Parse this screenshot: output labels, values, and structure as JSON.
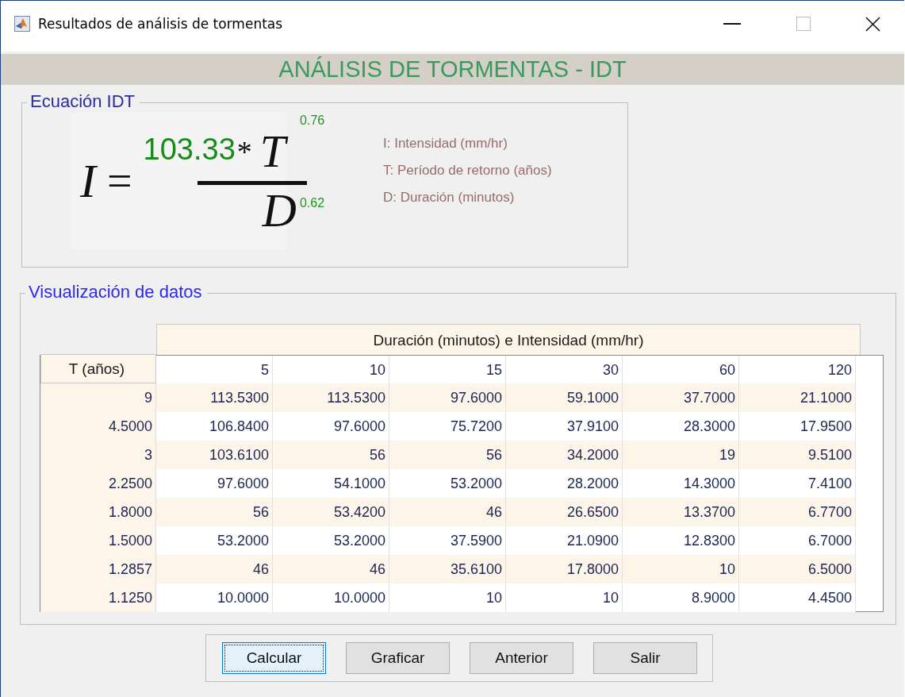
{
  "window": {
    "title": "Resultados de análisis de tormentas"
  },
  "banner": "ANÁLISIS DE TORMENTAS - IDT",
  "equation_panel": {
    "title": "Ecuación IDT",
    "formula": {
      "lhs": "I",
      "equals": "=",
      "coefficient": "103.33",
      "times": "*",
      "numerator_var": "T",
      "numerator_exponent": "0.76",
      "denominator_var": "D",
      "denominator_exponent": "0.62"
    },
    "legend": [
      "I: Intensidad (mm/hr)",
      "T: Período de retorno (años)",
      "D: Duración (minutos)"
    ]
  },
  "data_panel": {
    "title": "Visualización de datos",
    "table": {
      "group_header": "Duración (minutos) e Intensidad (mm/hr)",
      "row_header_title": "T (años)",
      "columns": [
        "5",
        "10",
        "15",
        "30",
        "60",
        "120"
      ],
      "rows": [
        {
          "t": "9",
          "values": [
            "113.5300",
            "113.5300",
            "97.6000",
            "59.1000",
            "37.7000",
            "21.1000"
          ]
        },
        {
          "t": "4.5000",
          "values": [
            "106.8400",
            "97.6000",
            "75.7200",
            "37.9100",
            "28.3000",
            "17.9500"
          ]
        },
        {
          "t": "3",
          "values": [
            "103.6100",
            "56",
            "56",
            "34.2000",
            "19",
            "9.5100"
          ]
        },
        {
          "t": "2.2500",
          "values": [
            "97.6000",
            "54.1000",
            "53.2000",
            "28.2000",
            "14.3000",
            "7.4100"
          ]
        },
        {
          "t": "1.8000",
          "values": [
            "56",
            "53.4200",
            "46",
            "26.6500",
            "13.3700",
            "6.7700"
          ]
        },
        {
          "t": "1.5000",
          "values": [
            "53.2000",
            "53.2000",
            "37.5900",
            "21.0900",
            "12.8300",
            "6.7000"
          ]
        },
        {
          "t": "1.2857",
          "values": [
            "46",
            "46",
            "35.6100",
            "17.8000",
            "10",
            "6.5000"
          ]
        },
        {
          "t": "1.1250",
          "values": [
            "10.0000",
            "10.0000",
            "10",
            "10",
            "8.9000",
            "4.4500"
          ]
        }
      ]
    }
  },
  "buttons": [
    {
      "label": "Calcular",
      "focused": true
    },
    {
      "label": "Graficar",
      "focused": false
    },
    {
      "label": "Anterior",
      "focused": false
    },
    {
      "label": "Salir",
      "focused": false
    }
  ]
}
